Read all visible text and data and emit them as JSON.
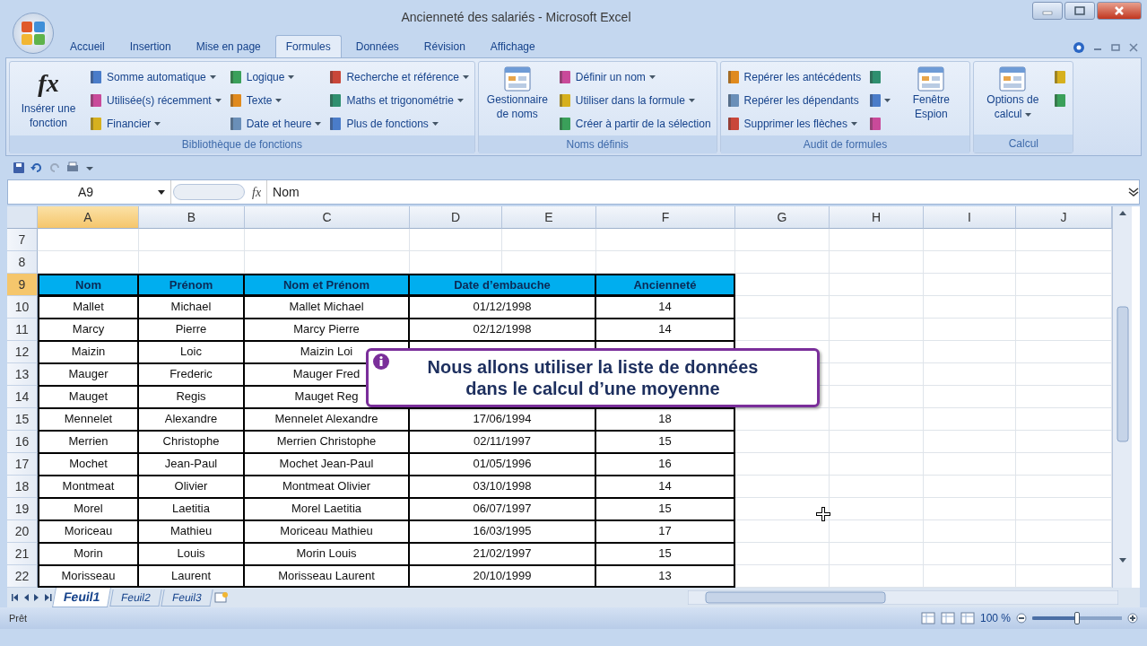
{
  "window": {
    "title": "Ancienneté des salariés - Microsoft Excel"
  },
  "ribbon_tabs": [
    {
      "label": "Accueil",
      "selected": false
    },
    {
      "label": "Insertion",
      "selected": false
    },
    {
      "label": "Mise en page",
      "selected": false
    },
    {
      "label": "Formules",
      "selected": true
    },
    {
      "label": "Données",
      "selected": false
    },
    {
      "label": "Révision",
      "selected": false
    },
    {
      "label": "Affichage",
      "selected": false
    }
  ],
  "ribbon_groups": [
    {
      "title": "Bibliothèque de fonctions",
      "items": [
        {
          "kind": "large",
          "symbol": "fx",
          "label": "Insérer une fonction",
          "dropdown": false
        },
        {
          "kind": "column",
          "items": [
            {
              "label": "Somme automatique",
              "dropdown": true
            },
            {
              "label": "Utilisée(s) récemment",
              "dropdown": true
            },
            {
              "label": "Financier",
              "dropdown": true
            }
          ]
        },
        {
          "kind": "column",
          "items": [
            {
              "label": "Logique",
              "dropdown": true
            },
            {
              "label": "Texte",
              "dropdown": true
            },
            {
              "label": "Date et heure",
              "dropdown": true
            }
          ]
        },
        {
          "kind": "column",
          "items": [
            {
              "label": "Recherche et référence",
              "dropdown": true
            },
            {
              "label": "Maths et trigonométrie",
              "dropdown": true
            },
            {
              "label": "Plus de fonctions",
              "dropdown": true
            }
          ]
        }
      ]
    },
    {
      "title": "Noms définis",
      "items": [
        {
          "kind": "large",
          "label": "Gestionnaire de noms",
          "dropdown": false
        },
        {
          "kind": "column",
          "items": [
            {
              "label": "Définir un nom",
              "dropdown": true
            },
            {
              "label": "Utiliser dans la formule",
              "dropdown": true
            },
            {
              "label": "Créer à partir de la sélection",
              "dropdown": false
            }
          ]
        }
      ]
    },
    {
      "title": "Audit de formules",
      "items": [
        {
          "kind": "column",
          "items": [
            {
              "label": "Repérer les antécédents",
              "dropdown": false
            },
            {
              "label": "Repérer les dépendants",
              "dropdown": false
            },
            {
              "label": "Supprimer les flèches",
              "dropdown": true
            }
          ]
        },
        {
          "kind": "icon_column",
          "buttons": [
            {
              "dropdown": false
            },
            {
              "dropdown": true
            },
            {
              "dropdown": false
            }
          ]
        },
        {
          "kind": "large",
          "label": "Fenêtre Espion",
          "dropdown": false
        }
      ]
    },
    {
      "title": "Calcul",
      "items": [
        {
          "kind": "large",
          "label": "Options de calcul",
          "dropdown": true
        },
        {
          "kind": "icon_column",
          "buttons": [
            {
              "dropdown": false
            },
            {
              "dropdown": false
            }
          ]
        }
      ]
    }
  ],
  "formula_bar": {
    "name_box": "A9",
    "fx": "fx",
    "formula": "Nom"
  },
  "columns": [
    {
      "label": "A",
      "selected": true
    },
    {
      "label": "B",
      "selected": false
    },
    {
      "label": "C",
      "selected": false
    },
    {
      "label": "D",
      "selected": false
    },
    {
      "label": "E",
      "selected": false
    },
    {
      "label": "F",
      "selected": false
    },
    {
      "label": "G",
      "selected": false
    },
    {
      "label": "H",
      "selected": false
    },
    {
      "label": "I",
      "selected": false
    },
    {
      "label": "J",
      "selected": false
    }
  ],
  "rows": [
    {
      "number": "7",
      "selected": false
    },
    {
      "number": "8",
      "selected": false
    },
    {
      "number": "9",
      "selected": true,
      "kind": "header",
      "cells": [
        "Nom",
        "Prénom",
        "Nom et Prénom",
        "Date d’embauche",
        "Ancienneté"
      ]
    },
    {
      "number": "10",
      "selected": false,
      "kind": "data",
      "cells": [
        "Mallet",
        "Michael",
        "Mallet Michael",
        "01/12/1998",
        "14"
      ]
    },
    {
      "number": "11",
      "selected": false,
      "kind": "data",
      "cells": [
        "Marcy",
        "Pierre",
        "Marcy Pierre",
        "02/12/1998",
        "14"
      ]
    },
    {
      "number": "12",
      "selected": false,
      "kind": "data",
      "cells": [
        "Maizin",
        "Loic",
        "Maizin Loi"
      ]
    },
    {
      "number": "13",
      "selected": false,
      "kind": "data",
      "cells": [
        "Mauger",
        "Frederic",
        "Mauger Fred"
      ]
    },
    {
      "number": "14",
      "selected": false,
      "kind": "data",
      "cells": [
        "Mauget",
        "Regis",
        "Mauget Reg"
      ]
    },
    {
      "number": "15",
      "selected": false,
      "kind": "data",
      "cells": [
        "Mennelet",
        "Alexandre",
        "Mennelet Alexandre",
        "17/06/1994",
        "18"
      ]
    },
    {
      "number": "16",
      "selected": false,
      "kind": "data",
      "cells": [
        "Merrien",
        "Christophe",
        "Merrien Christophe",
        "02/11/1997",
        "15"
      ]
    },
    {
      "number": "17",
      "selected": false,
      "kind": "data",
      "cells": [
        "Mochet",
        "Jean-Paul",
        "Mochet Jean-Paul",
        "01/05/1996",
        "16"
      ]
    },
    {
      "number": "18",
      "selected": false,
      "kind": "data",
      "cells": [
        "Montmeat",
        "Olivier",
        "Montmeat Olivier",
        "03/10/1998",
        "14"
      ]
    },
    {
      "number": "19",
      "selected": false,
      "kind": "data",
      "cells": [
        "Morel",
        "Laetitia",
        "Morel Laetitia",
        "06/07/1997",
        "15"
      ]
    },
    {
      "number": "20",
      "selected": false,
      "kind": "data",
      "cells": [
        "Moriceau",
        "Mathieu",
        "Moriceau Mathieu",
        "16/03/1995",
        "17"
      ]
    },
    {
      "number": "21",
      "selected": false,
      "kind": "data",
      "cells": [
        "Morin",
        "Louis",
        "Morin Louis",
        "21/02/1997",
        "15"
      ]
    },
    {
      "number": "22",
      "selected": false,
      "kind": "data",
      "cells": [
        "Morisseau",
        "Laurent",
        "Morisseau Laurent",
        "20/10/1999",
        "13"
      ]
    }
  ],
  "callout": {
    "lines": [
      "Nous allons utiliser la liste de données",
      "dans le calcul d’une moyenne"
    ]
  },
  "sheet_tabs": [
    {
      "label": "Feuil1",
      "selected": true
    },
    {
      "label": "Feuil2",
      "selected": false
    },
    {
      "label": "Feuil3",
      "selected": false
    }
  ],
  "status_bar": {
    "status": "Prêt",
    "zoom": "100 %",
    "zoom_slider": {
      "level": 0.5
    }
  }
}
